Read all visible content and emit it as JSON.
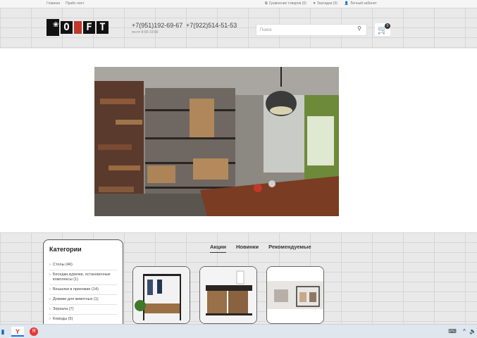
{
  "topbar": {
    "links": [
      "Главная",
      "Прайс-лист"
    ],
    "compare": "Сравнение товаров (0)",
    "bookmarks": "Закладки (0)",
    "account": "Личный кабинет"
  },
  "header": {
    "phone1": "+7(951)192-69-67",
    "phone2": "+7(922)514-51-53",
    "hours": "пн-пт 8:00-19:00",
    "search_placeholder": "Поиск",
    "cart_count": "0",
    "logo_letters": [
      "O",
      "F",
      "T"
    ]
  },
  "categories": {
    "title": "Категории",
    "items": [
      "Столы (46)",
      "Беседки,курилки, остановочные комплексы (1)",
      "Вешалки в прихожие (14)",
      "Домики для животных (1)",
      "Зеркала (7)",
      "Комоды (5)"
    ]
  },
  "tabs": [
    "Акции",
    "Новинки",
    "Рекомендуемые"
  ],
  "icons": {
    "compare": "copy-icon",
    "bookmarks": "heart-icon",
    "account": "user-icon",
    "search": "search-icon",
    "cart": "cart-icon"
  },
  "taskbar": {
    "yandex_label": "Я",
    "browser_label": "Y"
  },
  "colors": {
    "accent": "#c0392b",
    "dark": "#111111"
  }
}
